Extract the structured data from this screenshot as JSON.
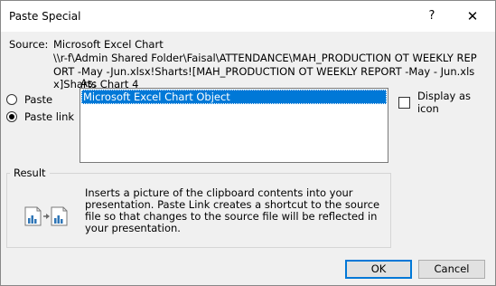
{
  "window": {
    "title": "Paste Special",
    "help_glyph": "?",
    "close_glyph": "✕"
  },
  "source": {
    "label": "Source:",
    "name": "Microsoft Excel Chart",
    "path": "\\\\r-f\\Admin Shared Folder\\Faisal\\ATTENDANCE\\MAH_PRODUCTION OT WEEKLY REPORT -May -Jun.xlsx!Sharts![MAH_PRODUCTION OT WEEKLY REPORT -May - Jun.xlsx]Sharts Chart 4"
  },
  "as_label": "As:",
  "options": {
    "paste": {
      "label": "Paste",
      "selected": false
    },
    "paste_link": {
      "label": "Paste link",
      "selected": true
    }
  },
  "list": {
    "items": [
      "Microsoft Excel Chart Object"
    ],
    "selected_index": 0
  },
  "display_as_icon": {
    "label": "Display as icon",
    "checked": false
  },
  "result": {
    "legend": "Result",
    "text": "Inserts a picture of the clipboard contents into your presentation. Paste Link creates a shortcut to the source file so that changes to the source file will be reflected in your presentation.",
    "icon": "paste-link-chart-icon"
  },
  "buttons": {
    "ok": "OK",
    "cancel": "Cancel"
  },
  "colors": {
    "selection": "#0078d7",
    "dialog_bg": "#f0f0f0",
    "titlebar_bg": "#ffffff"
  }
}
